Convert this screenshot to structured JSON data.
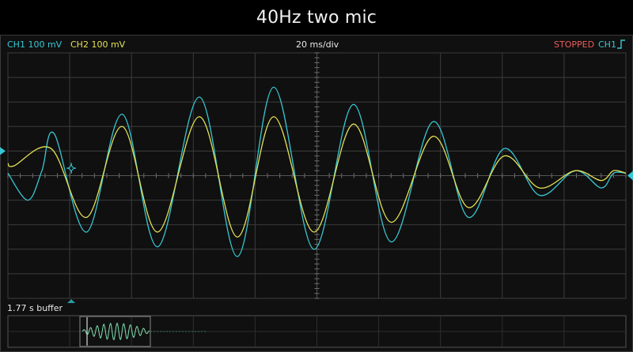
{
  "window": {
    "title": "40Hz two mic"
  },
  "status": {
    "ch1_label": "CH1 100 mV",
    "ch2_label": "CH2 100 mV",
    "timebase": "20 ms/div",
    "run_state": "STOPPED",
    "trigger_channel": "CH1",
    "trigger_edge_icon": "rising-edge-icon"
  },
  "buffer": {
    "label": "1.77 s buffer"
  },
  "colors": {
    "ch1": "#37c8d4",
    "ch2": "#e3e156",
    "stopped": "#ef5a5a",
    "grid": "#3c3c3c"
  },
  "chart_data": {
    "type": "line",
    "title": "40Hz two mic",
    "xlabel": "",
    "ylabel": "",
    "grid": true,
    "x_divisions": 10,
    "y_divisions": 10,
    "x_units_per_div": "20 ms",
    "y_units_per_div": "100 mV",
    "xlim": [
      0,
      200
    ],
    "ylim": [
      -500,
      500
    ],
    "series": [
      {
        "name": "CH1",
        "x": [
          0,
          6.5,
          11,
          15,
          25.5,
          37,
          48.5,
          62,
          74.3,
          86,
          99,
          111.8,
          124,
          137.6,
          149,
          160.6,
          172,
          183.6,
          192,
          196,
          200
        ],
        "values": [
          10,
          -100,
          20,
          170,
          -230,
          250,
          -290,
          320,
          -330,
          360,
          -300,
          290,
          -270,
          220,
          -170,
          110,
          -80,
          20,
          -50,
          10,
          10
        ]
      },
      {
        "name": "CH2",
        "x": [
          0,
          2,
          14,
          25.5,
          37,
          48.5,
          62,
          74.3,
          86,
          99,
          111.8,
          124,
          137.6,
          149,
          160.6,
          172,
          183.6,
          192,
          196,
          200
        ],
        "values": [
          50,
          40,
          110,
          -170,
          200,
          -230,
          240,
          -250,
          240,
          -230,
          210,
          -190,
          160,
          -130,
          80,
          -50,
          20,
          -20,
          20,
          10
        ]
      }
    ]
  }
}
